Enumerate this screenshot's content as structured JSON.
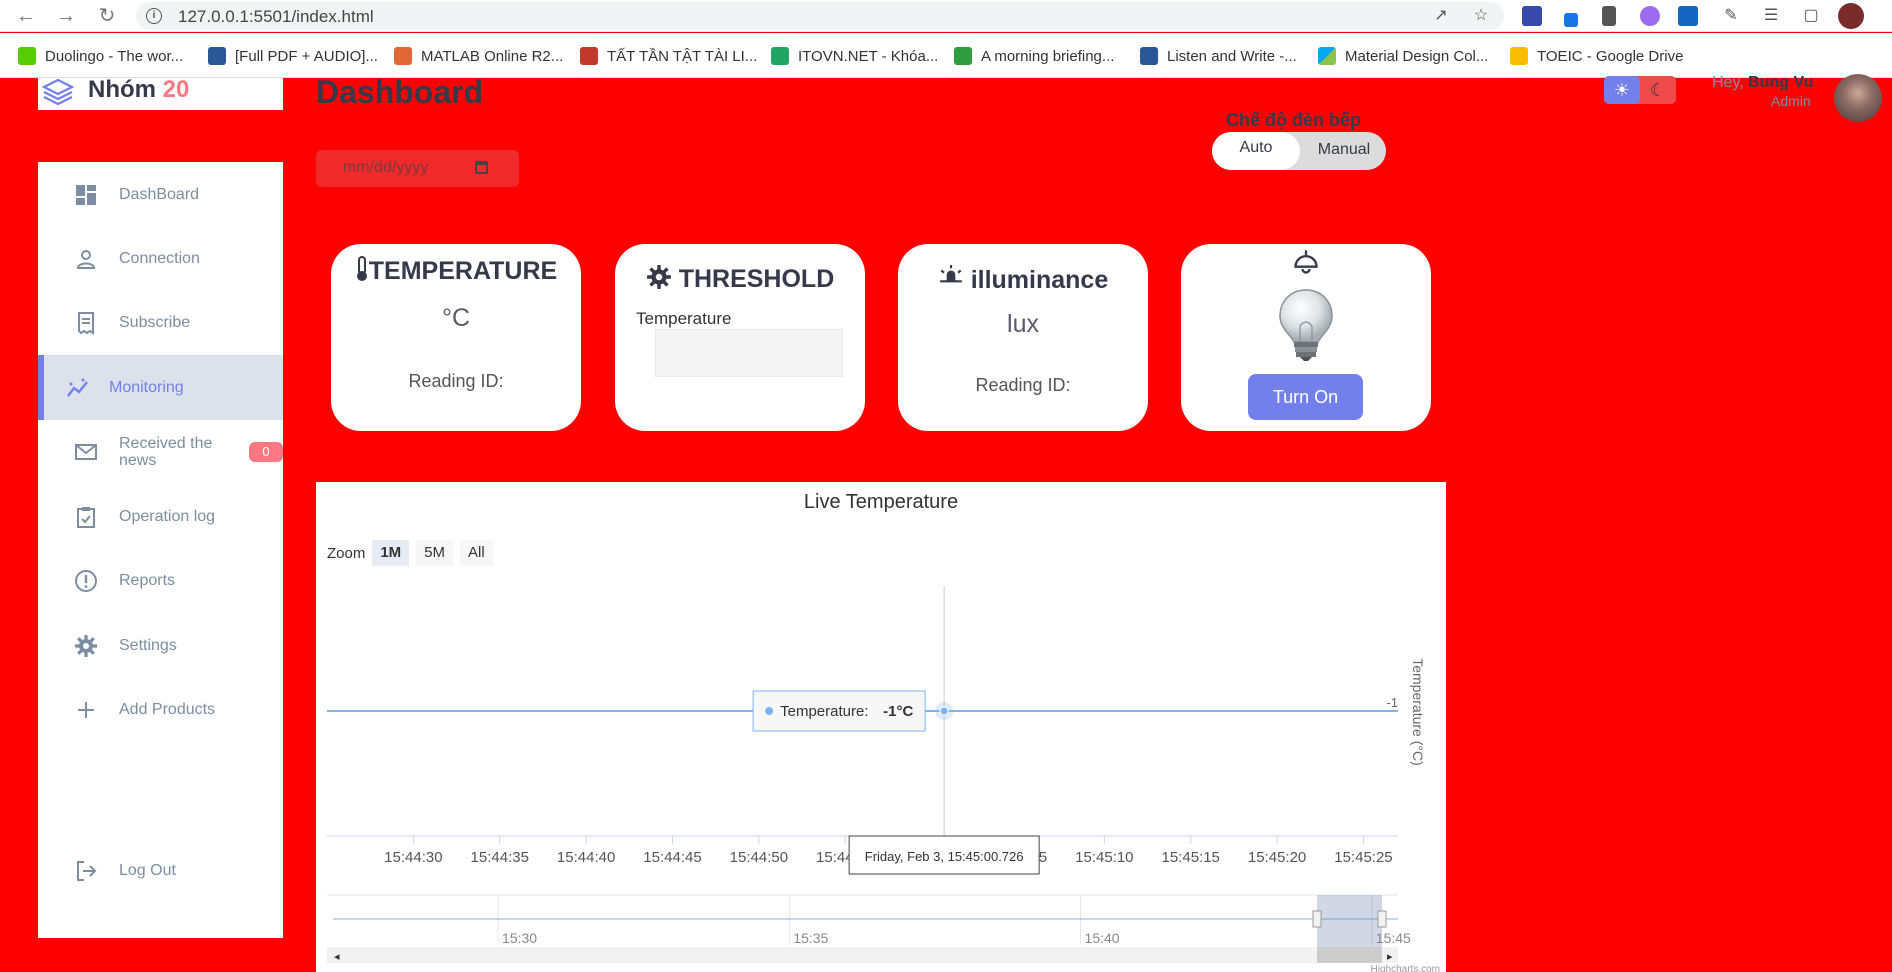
{
  "browser": {
    "url": "127.0.0.1:5501/index.html",
    "bookmarks": [
      {
        "label": "Duolingo - The wor...",
        "color": "#58cc02"
      },
      {
        "label": "[Full PDF + AUDIO]...",
        "color": "#2b5797"
      },
      {
        "label": "MATLAB Online R2...",
        "color": "#e16737"
      },
      {
        "label": "TẤT TẦN TẬT TÀI LI...",
        "color": "#c0392b"
      },
      {
        "label": "ITOVN.NET - Khóa...",
        "color": "#1fa463"
      },
      {
        "label": "A morning briefing...",
        "color": "#2e9c3f"
      },
      {
        "label": "Listen and Write -...",
        "color": "#2b5797"
      },
      {
        "label": "Material Design Col...",
        "color": "#03a9f4"
      },
      {
        "label": "TOEIC - Google Drive",
        "color": "#fbbc04"
      }
    ]
  },
  "sidebar": {
    "logo": {
      "name": "Nhóm",
      "number": "20"
    },
    "items": [
      {
        "label": "DashBoard",
        "icon": "grid-icon"
      },
      {
        "label": "Connection",
        "icon": "person-icon"
      },
      {
        "label": "Subscribe",
        "icon": "receipt-icon"
      },
      {
        "label": "Monitoring",
        "icon": "insights-icon",
        "active": true
      },
      {
        "label": "Received the news",
        "icon": "mail-icon",
        "badge": "0"
      },
      {
        "label": "Operation log",
        "icon": "clipboard-icon"
      },
      {
        "label": "Reports",
        "icon": "report-icon"
      },
      {
        "label": "Settings",
        "icon": "gear-icon"
      },
      {
        "label": "Add Products",
        "icon": "plus-icon"
      }
    ],
    "logout": "Log Out"
  },
  "main": {
    "title": "Dashboard",
    "date_placeholder": "mm/dd/yyyy",
    "mode": {
      "label": "Chế độ đèn bếp",
      "auto": "Auto",
      "manual": "Manual"
    },
    "profile": {
      "hey": "Hey,",
      "name": "Bung Vu",
      "role": "Admin"
    },
    "cards": {
      "temperature": {
        "title": "TEMPERATURE",
        "unit": "°C",
        "reading": "Reading ID:"
      },
      "threshold": {
        "title": "THRESHOLD",
        "field_label": "Temperature"
      },
      "illuminance": {
        "title": "illuminance",
        "unit": "lux",
        "reading": "Reading ID:"
      },
      "light": {
        "button": "Turn On"
      }
    }
  },
  "chart_data": {
    "type": "line",
    "title": "Live Temperature",
    "ylabel": "Temperature (°C)",
    "zoom_label": "Zoom",
    "zoom_buttons": [
      "1M",
      "5M",
      "All"
    ],
    "zoom_selected": "1M",
    "x_ticks": [
      "15:44:30",
      "15:44:35",
      "15:44:40",
      "15:44:45",
      "15:44:50",
      "15:44:55",
      "15:45:00",
      "15:45:05",
      "15:45:10",
      "15:45:15",
      "15:45:20",
      "15:45:25"
    ],
    "y_tick": "-1",
    "series": [
      {
        "name": "Temperature",
        "x": [
          "15:44:25",
          "15:45:27"
        ],
        "values": [
          -1,
          -1
        ]
      }
    ],
    "tooltip": {
      "series": "Temperature:",
      "value": "-1°C",
      "time": "Friday, Feb 3, 15:45:00.726"
    },
    "navigator_ticks": [
      "15:30",
      "15:35",
      "15:40",
      "15:45"
    ],
    "credits": "Highcharts.com"
  }
}
